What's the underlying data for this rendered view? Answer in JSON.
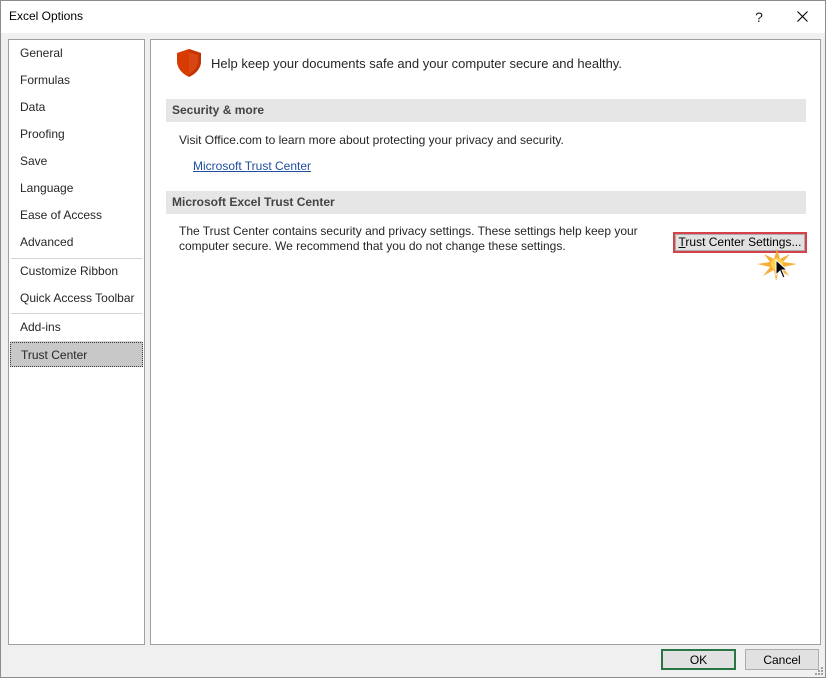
{
  "window": {
    "title": "Excel Options",
    "help_label": "?"
  },
  "nav": {
    "items": [
      {
        "label": "General"
      },
      {
        "label": "Formulas"
      },
      {
        "label": "Data"
      },
      {
        "label": "Proofing"
      },
      {
        "label": "Save"
      },
      {
        "label": "Language"
      },
      {
        "label": "Ease of Access"
      },
      {
        "label": "Advanced"
      },
      {
        "label": "Customize Ribbon"
      },
      {
        "label": "Quick Access Toolbar"
      },
      {
        "label": "Add-ins"
      },
      {
        "label": "Trust Center"
      }
    ],
    "selected": "Trust Center"
  },
  "content": {
    "intro": "Help keep your documents safe and your computer secure and healthy.",
    "security_section": {
      "header": "Security & more",
      "description": "Visit Office.com to learn more about protecting your privacy and security.",
      "link": "Microsoft Trust Center"
    },
    "trust_center_section": {
      "header": "Microsoft Excel Trust Center",
      "description": "The Trust Center contains security and privacy settings. These settings help keep your computer secure. We recommend that you do not change these settings.",
      "button_access_key": "T",
      "button_rest": "rust Center Settings..."
    }
  },
  "footer": {
    "ok_label": "OK",
    "cancel_label": "Cancel"
  },
  "colors": {
    "shield": "#d83b01",
    "highlight_border": "#d6424a",
    "ok_border": "#2a7544",
    "link": "#1f4e9e"
  }
}
